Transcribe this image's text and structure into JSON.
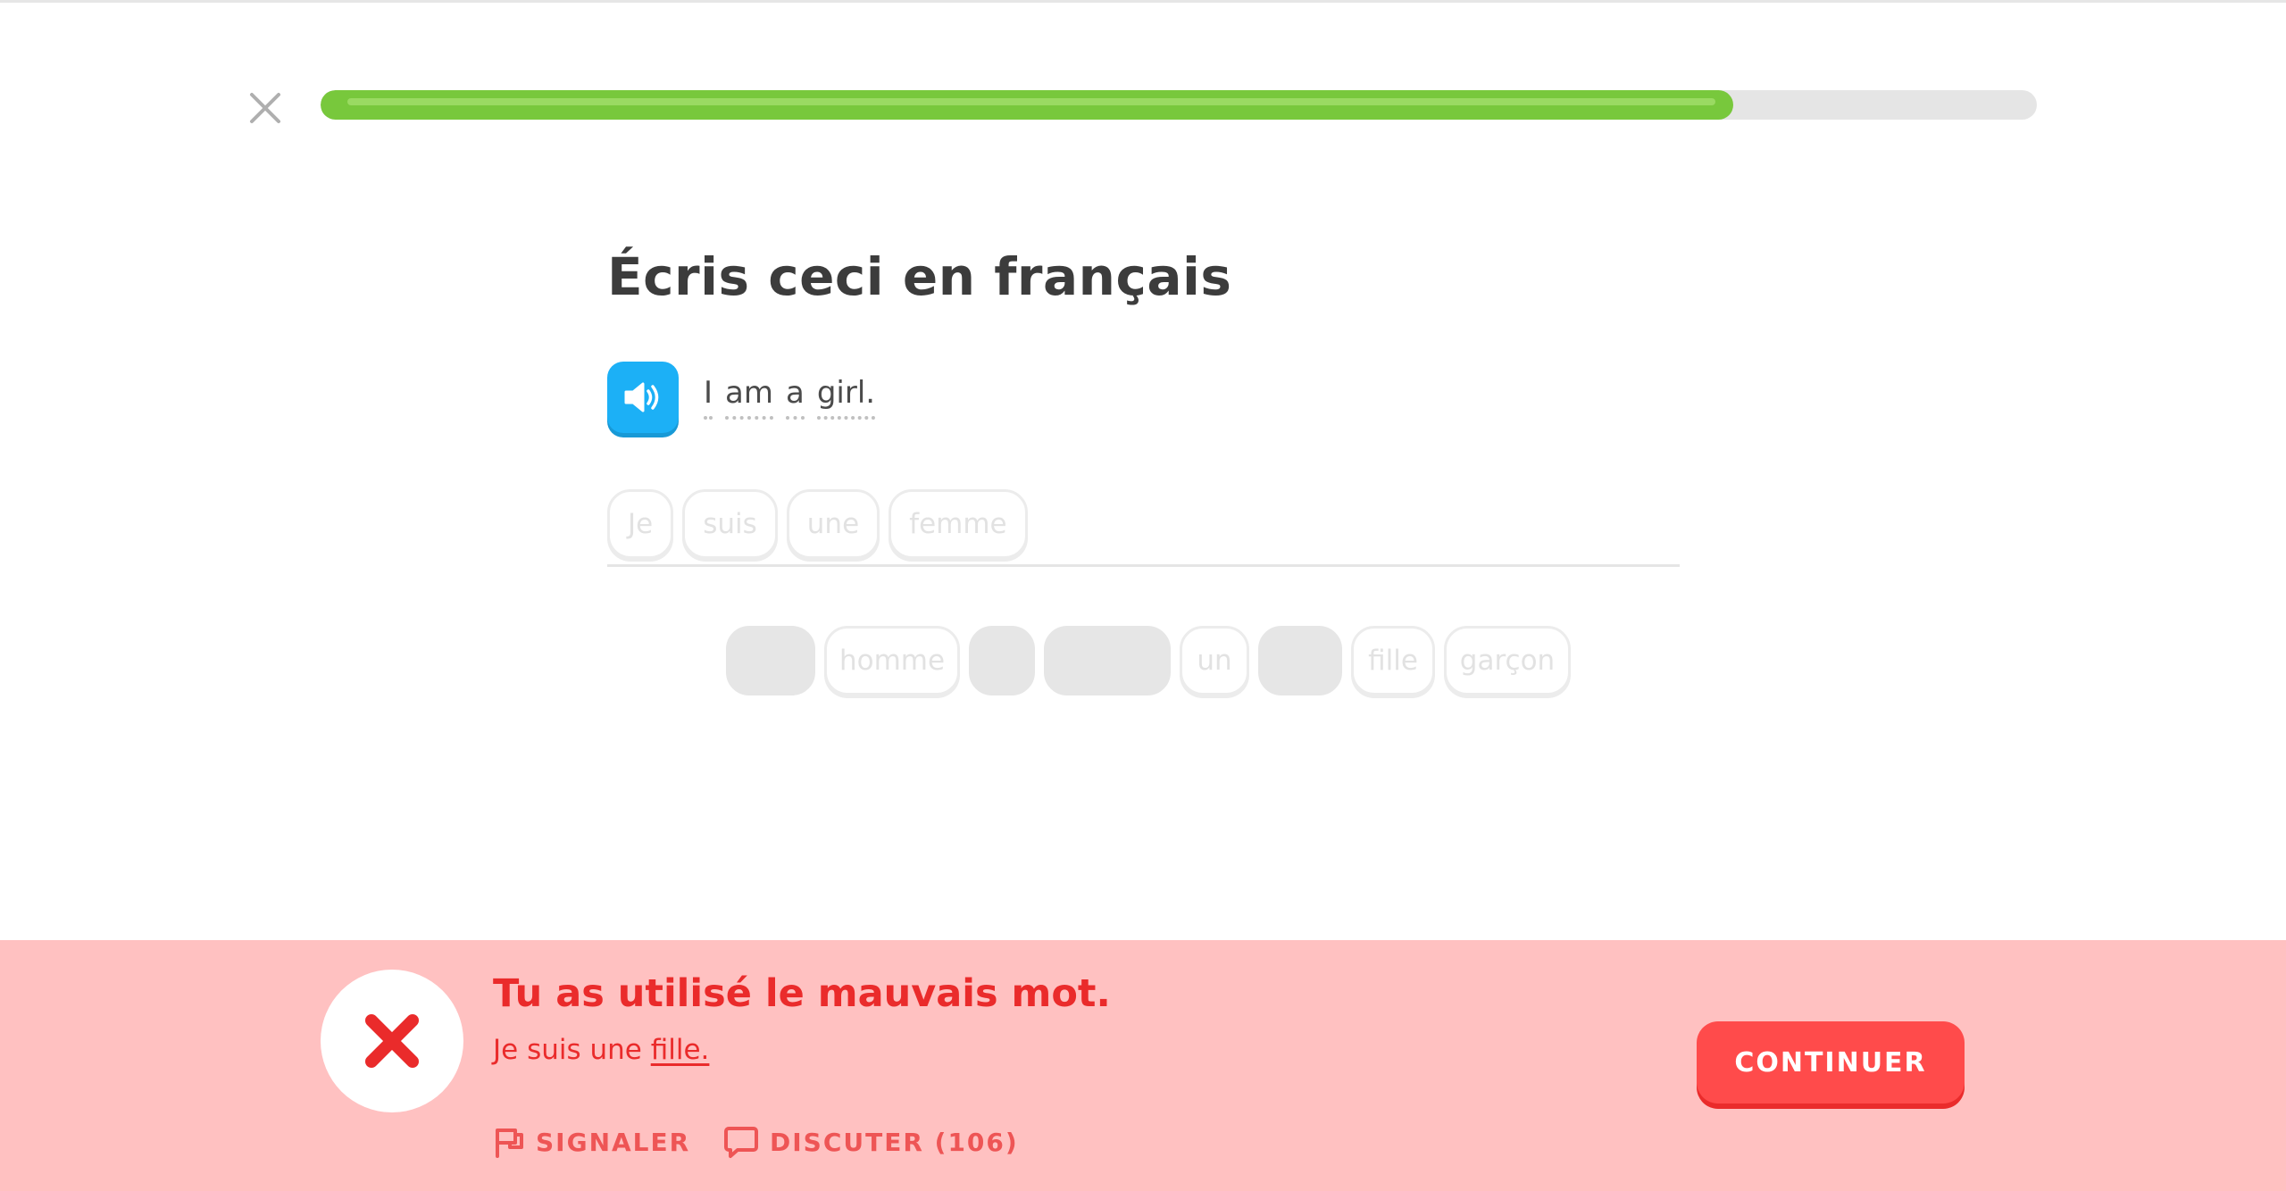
{
  "lesson": {
    "progress_fraction": 0.823
  },
  "exercise": {
    "instruction": "Écris ceci en français",
    "prompt_words": [
      "I",
      "am",
      "a",
      "girl."
    ]
  },
  "answer_tiles": [
    "Je",
    "suis",
    "une",
    "femme"
  ],
  "word_bank": [
    {
      "label": "",
      "filled": true
    },
    {
      "label": "homme",
      "filled": false
    },
    {
      "label": "",
      "filled": true
    },
    {
      "label": "",
      "filled": true
    },
    {
      "label": "un",
      "filled": false
    },
    {
      "label": "",
      "filled": true
    },
    {
      "label": "fille",
      "filled": false
    },
    {
      "label": "garçon",
      "filled": false
    }
  ],
  "feedback": {
    "title": "Tu as utilisé le mauvais mot.",
    "correct_prefix": "Je suis une ",
    "correct_highlight": "fille.",
    "report_label": "SIGNALER",
    "discuss_label": "DISCUTER (106)",
    "continue_label": "CONTINUER"
  },
  "colors": {
    "progress": "#78c83c",
    "speaker": "#1cb0f6",
    "feedback_bg": "#ffc1c1",
    "error": "#ea2b2b",
    "continue": "#ff4b4b"
  },
  "icons": {
    "close": "close-icon",
    "speaker": "speaker-icon",
    "wrong": "x-mark-icon",
    "report": "flag-icon",
    "discuss": "speech-bubble-icon"
  }
}
